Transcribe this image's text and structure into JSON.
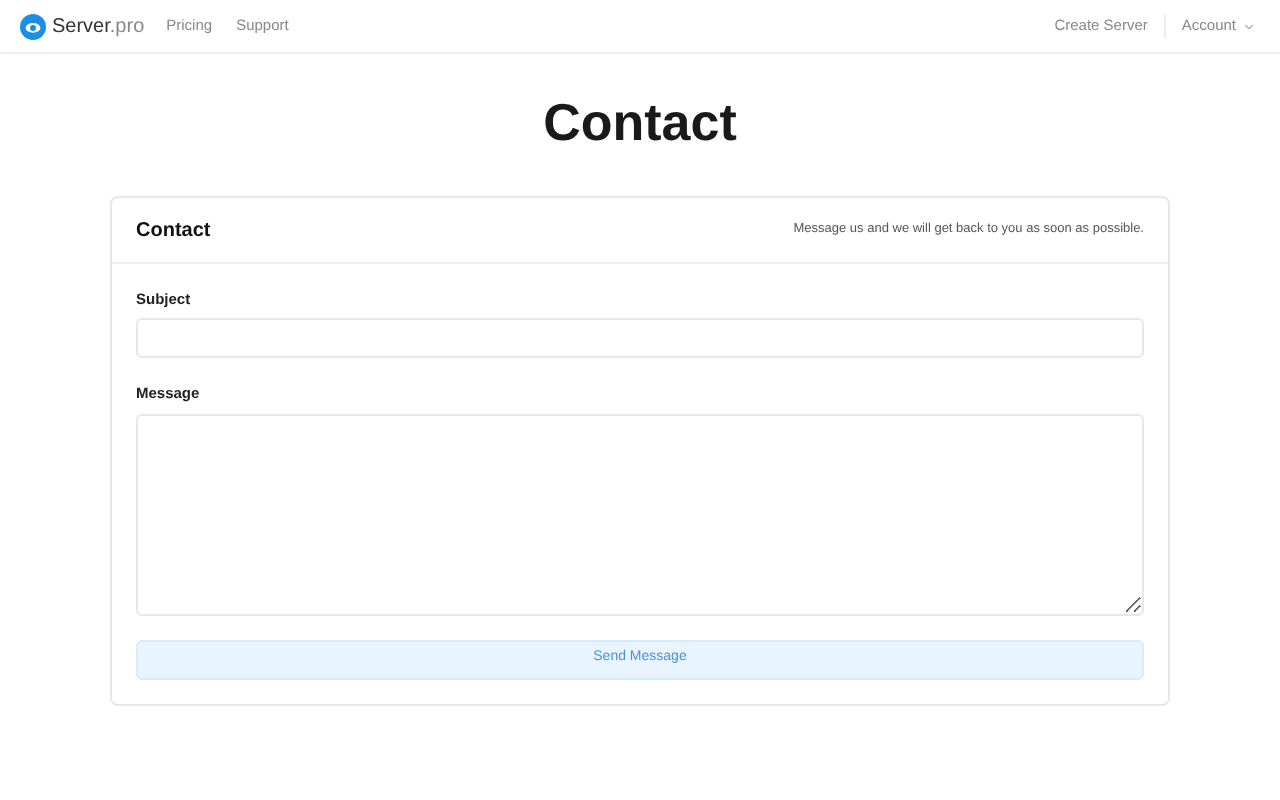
{
  "nav": {
    "brand": {
      "name": "Server",
      "suffix": ".pro"
    },
    "links": [
      "Pricing",
      "Support"
    ],
    "right_links": [
      "Create Server"
    ],
    "account": "Account"
  },
  "page_title": "Contact",
  "card": {
    "title": "Contact",
    "subtitle": "Message us and we will get back to you as soon as possible.",
    "fields": [
      {
        "label": "Subject",
        "kind": "input"
      },
      {
        "label": "Message",
        "kind": "textarea"
      }
    ],
    "submit": "Send Message"
  }
}
